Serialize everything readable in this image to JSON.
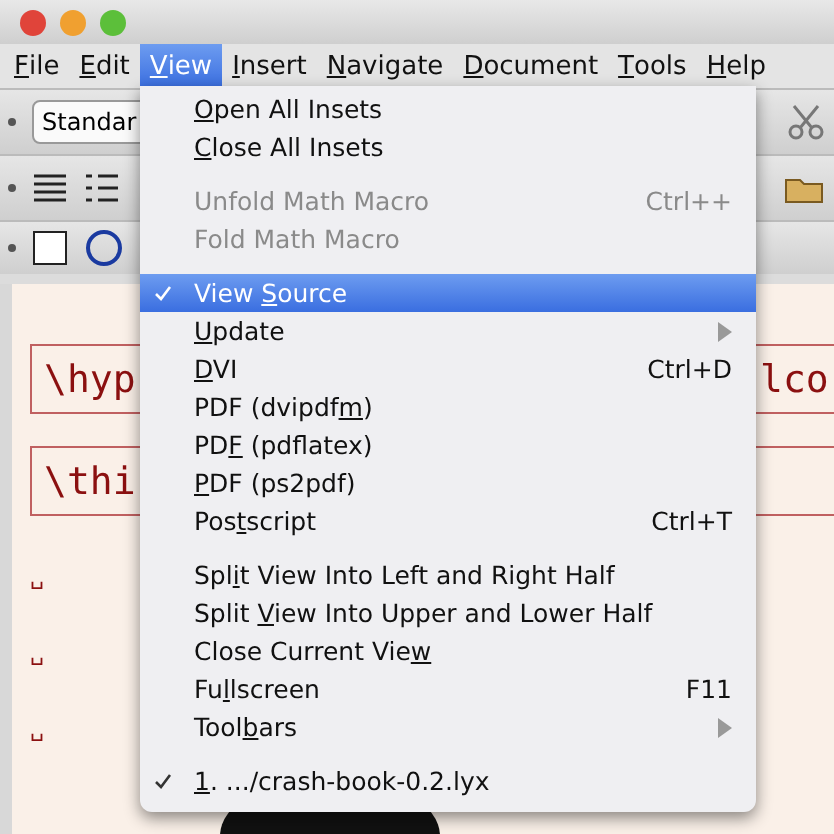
{
  "window": {
    "controls": [
      {
        "color": "#e0443a"
      },
      {
        "color": "#f0a030"
      },
      {
        "color": "#5cbf3a"
      }
    ]
  },
  "menubar": [
    {
      "mnemonic": "F",
      "label_after": "ile",
      "selected": false
    },
    {
      "mnemonic": "E",
      "label_after": "dit",
      "selected": false
    },
    {
      "mnemonic": "V",
      "label_after": "iew",
      "selected": true
    },
    {
      "mnemonic": "I",
      "label_after": "nsert",
      "selected": false
    },
    {
      "mnemonic": "N",
      "label_after": "avigate",
      "selected": false
    },
    {
      "mnemonic": "D",
      "label_after": "ocument",
      "selected": false
    },
    {
      "mnemonic": "T",
      "label_after": "ools",
      "selected": false
    },
    {
      "mnemonic": "H",
      "label_after": "elp",
      "selected": false
    }
  ],
  "toolbar": {
    "layout_combo": {
      "value": "Standar"
    }
  },
  "document": {
    "insets": [
      {
        "text": "\\hyp",
        "text_right": "lco"
      },
      {
        "text": "\\thi"
      }
    ],
    "space_marks": [
      "␣",
      "␣",
      "␣"
    ]
  },
  "view_menu": {
    "items": [
      {
        "kind": "item",
        "mnemonic": "O",
        "label_after": "pen All Insets",
        "disabled": false,
        "checked": false,
        "selected": false,
        "submenu": false
      },
      {
        "kind": "item",
        "mnemonic": "C",
        "label_after": "lose All Insets",
        "disabled": false,
        "checked": false,
        "selected": false,
        "submenu": false
      },
      {
        "kind": "separator"
      },
      {
        "kind": "item",
        "label_before": "Unfold Math Macro",
        "shortcut": "Ctrl++",
        "disabled": true,
        "checked": false,
        "selected": false,
        "submenu": false
      },
      {
        "kind": "item",
        "label_before": "Fold Math Macro",
        "disabled": true,
        "checked": false,
        "selected": false,
        "submenu": false
      },
      {
        "kind": "separator"
      },
      {
        "kind": "item",
        "label_before": "View ",
        "mnemonic": "S",
        "label_after": "ource",
        "disabled": false,
        "checked": true,
        "selected": true,
        "submenu": false
      },
      {
        "kind": "item",
        "mnemonic": "U",
        "label_after": "pdate",
        "submenu": true,
        "disabled": false,
        "checked": false,
        "selected": false
      },
      {
        "kind": "item",
        "mnemonic": "D",
        "label_after": "VI",
        "shortcut": "Ctrl+D",
        "disabled": false,
        "checked": false,
        "selected": false,
        "submenu": false
      },
      {
        "kind": "item",
        "label_before": "PDF (dvipdf",
        "mnemonic": "m",
        "label_after": ")",
        "disabled": false,
        "checked": false,
        "selected": false,
        "submenu": false
      },
      {
        "kind": "item",
        "label_before": "PD",
        "mnemonic": "F",
        "label_after": " (pdflatex)",
        "disabled": false,
        "checked": false,
        "selected": false,
        "submenu": false
      },
      {
        "kind": "item",
        "mnemonic": "P",
        "label_after": "DF (ps2pdf)",
        "disabled": false,
        "checked": false,
        "selected": false,
        "submenu": false
      },
      {
        "kind": "item",
        "label_before": "Pos",
        "mnemonic": "t",
        "label_after": "script",
        "shortcut": "Ctrl+T",
        "disabled": false,
        "checked": false,
        "selected": false,
        "submenu": false
      },
      {
        "kind": "separator"
      },
      {
        "kind": "item",
        "label_before": "Spl",
        "mnemonic": "i",
        "label_after": "t View Into Left and Right Half",
        "disabled": false,
        "checked": false,
        "selected": false,
        "submenu": false
      },
      {
        "kind": "item",
        "label_before": "Split ",
        "mnemonic": "V",
        "label_after": "iew Into Upper and Lower Half",
        "disabled": false,
        "checked": false,
        "selected": false,
        "submenu": false
      },
      {
        "kind": "item",
        "label_before": "Close Current Vie",
        "mnemonic": "w",
        "disabled": false,
        "checked": false,
        "selected": false,
        "submenu": false
      },
      {
        "kind": "item",
        "label_before": "Fu",
        "mnemonic": "l",
        "label_after": "lscreen",
        "shortcut": "F11",
        "disabled": false,
        "checked": false,
        "selected": false,
        "submenu": false
      },
      {
        "kind": "item",
        "label_before": "Tool",
        "mnemonic": "b",
        "label_after": "ars",
        "submenu": true,
        "disabled": false,
        "checked": false,
        "selected": false
      },
      {
        "kind": "separator"
      },
      {
        "kind": "item",
        "mnemonic": "1",
        "label_after": ". .../crash-book-0.2.lyx",
        "disabled": false,
        "checked": true,
        "selected": false,
        "submenu": false
      }
    ]
  }
}
